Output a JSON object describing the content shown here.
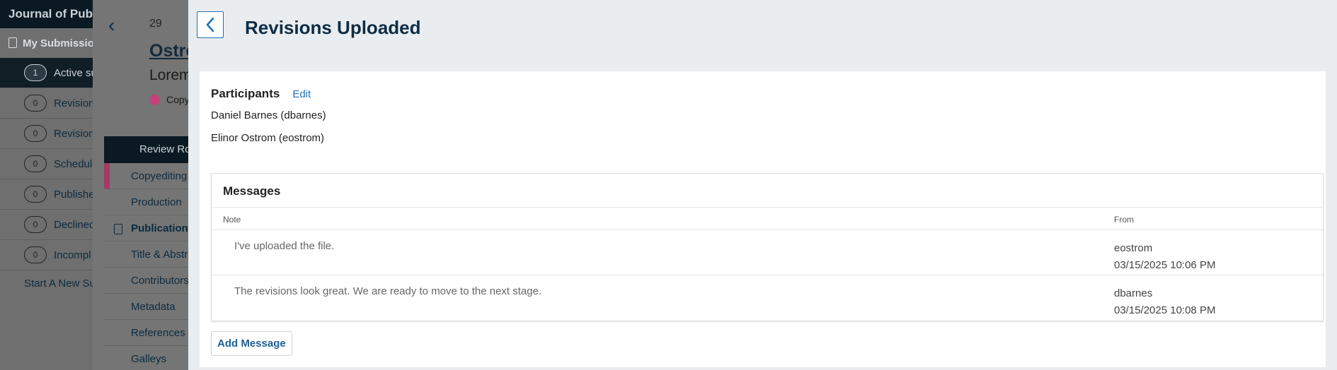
{
  "background": {
    "journal_name": "Journal of Publi",
    "my_submissions": "My Submissio",
    "nav_items": [
      {
        "count": "1",
        "label": "Active su"
      },
      {
        "count": "0",
        "label": "Revision"
      },
      {
        "count": "0",
        "label": "Revision"
      },
      {
        "count": "0",
        "label": "Schedule"
      },
      {
        "count": "0",
        "label": "Publishe"
      },
      {
        "count": "0",
        "label": "Declined"
      },
      {
        "count": "0",
        "label": "Incompl"
      }
    ],
    "start_new": "Start A New Su",
    "submission_id": "29",
    "author": "Ostro",
    "title": "Lorem",
    "stage": "Copy",
    "menu": {
      "review_rounds": "Review Ro",
      "items": [
        "Copyediting",
        "Production",
        "Publication",
        "Title & Abstr",
        "Contributors",
        "Metadata",
        "References",
        "Galleys"
      ]
    }
  },
  "modal": {
    "title": "Revisions Uploaded",
    "participants": {
      "heading": "Participants",
      "edit_label": "Edit",
      "people": [
        "Daniel Barnes (dbarnes)",
        "Elinor Ostrom (eostrom)"
      ]
    },
    "messages": {
      "heading": "Messages",
      "col_note": "Note",
      "col_from": "From",
      "rows": [
        {
          "note": "I've uploaded the file.",
          "from_user": "eostrom",
          "from_date": "03/15/2025 10:06 PM"
        },
        {
          "note": "The revisions look great. We are ready to move to the next stage.",
          "from_user": "dbarnes",
          "from_date": "03/15/2025 10:08 PM"
        }
      ]
    },
    "add_message_label": "Add Message"
  }
}
